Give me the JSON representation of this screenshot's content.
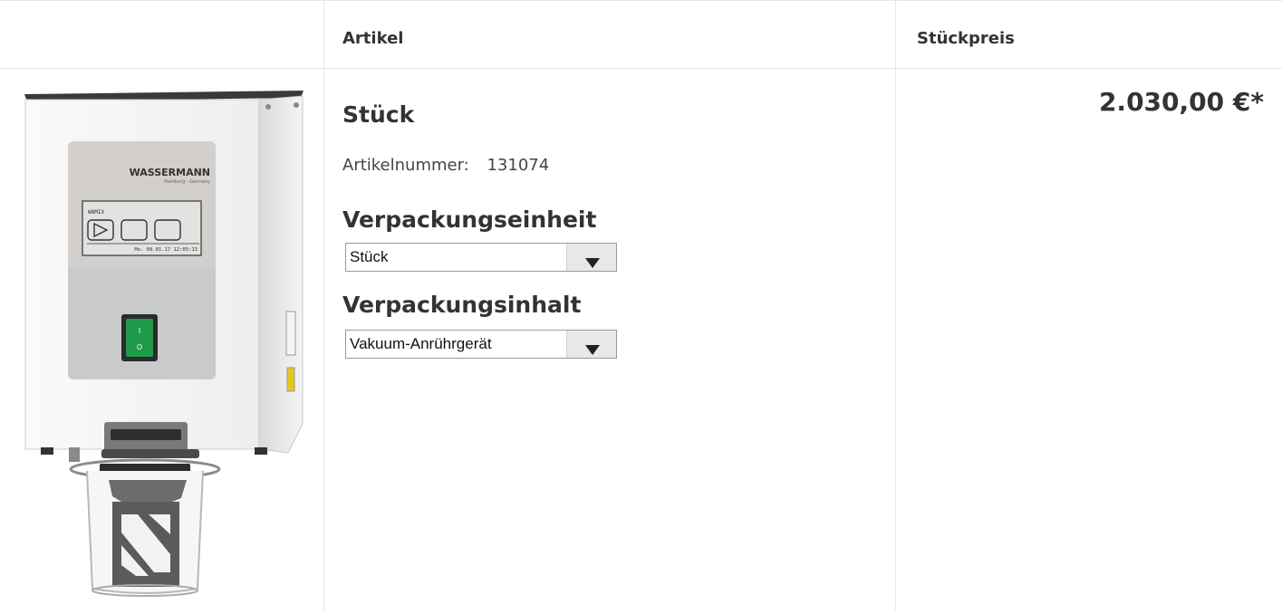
{
  "table": {
    "headers": {
      "article": "Artikel",
      "unit_price": "Stückpreis"
    }
  },
  "product": {
    "title": "Stück",
    "article_number_label": "Artikelnummer:",
    "article_number": "131074",
    "device_brand": "WASSERMANN",
    "device_subtitle": "Hamburg · Germany",
    "device_screen_title": "WAMIX",
    "device_screen_status": "Mo. 09.01.17 12:05:13",
    "packaging_unit": {
      "label": "Verpackungseinheit",
      "selected": "Stück"
    },
    "packaging_content": {
      "label": "Verpackungsinhalt",
      "selected": "Vakuum-Anrührgerät"
    },
    "price": "2.030,00 €*"
  },
  "colors": {
    "border": "#e6e6e6",
    "text": "#333333",
    "switch_green": "#1f9b4a"
  }
}
